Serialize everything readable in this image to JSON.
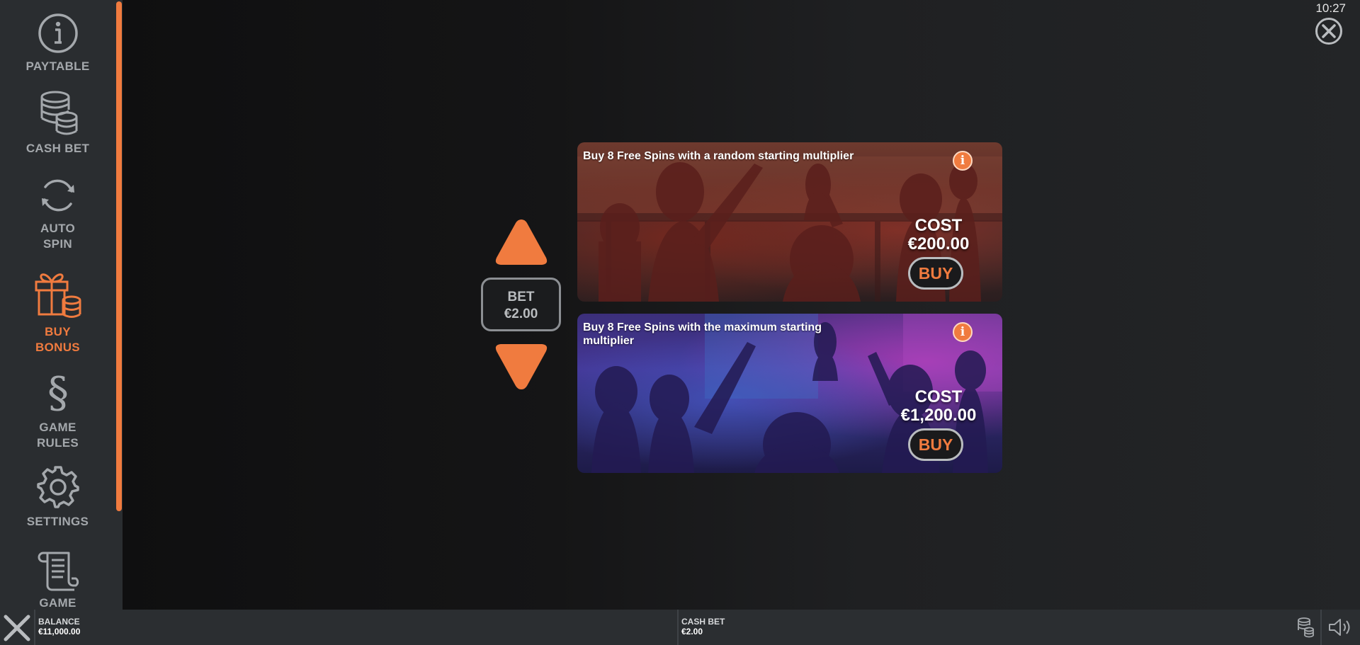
{
  "clock": "10:27",
  "sidebar": {
    "items": [
      {
        "label": "PAYTABLE",
        "icon": "info-circle-icon"
      },
      {
        "label": "CASH BET",
        "icon": "coin-stack-icon"
      },
      {
        "label": "AUTO SPIN",
        "icon": "refresh-icon"
      },
      {
        "label": "BUY BONUS",
        "icon": "gift-coins-icon",
        "active": true
      },
      {
        "label": "GAME RULES",
        "icon": "section-sign-icon"
      },
      {
        "label": "SETTINGS",
        "icon": "gear-icon"
      },
      {
        "label": "GAME",
        "icon": "scroll-icon"
      }
    ]
  },
  "bet": {
    "label": "BET",
    "value": "€2.00"
  },
  "offers": [
    {
      "title": "Buy 8 Free Spins with a random starting multiplier",
      "cost_label": "COST",
      "cost": "€200.00",
      "buy_label": "BUY",
      "info": "i"
    },
    {
      "title": "Buy 8 Free Spins with the maximum starting multiplier",
      "cost_label": "COST",
      "cost": "€1,200.00",
      "buy_label": "BUY",
      "info": "i"
    }
  ],
  "bottom_bar": {
    "balance_label": "BALANCE",
    "balance_value": "€11,000.00",
    "cash_bet_label": "CASH BET",
    "cash_bet_value": "€2.00"
  },
  "colors": {
    "accent": "#f07b3f",
    "sidebar_bg": "#2a2d30",
    "muted": "#a4a8ac"
  }
}
